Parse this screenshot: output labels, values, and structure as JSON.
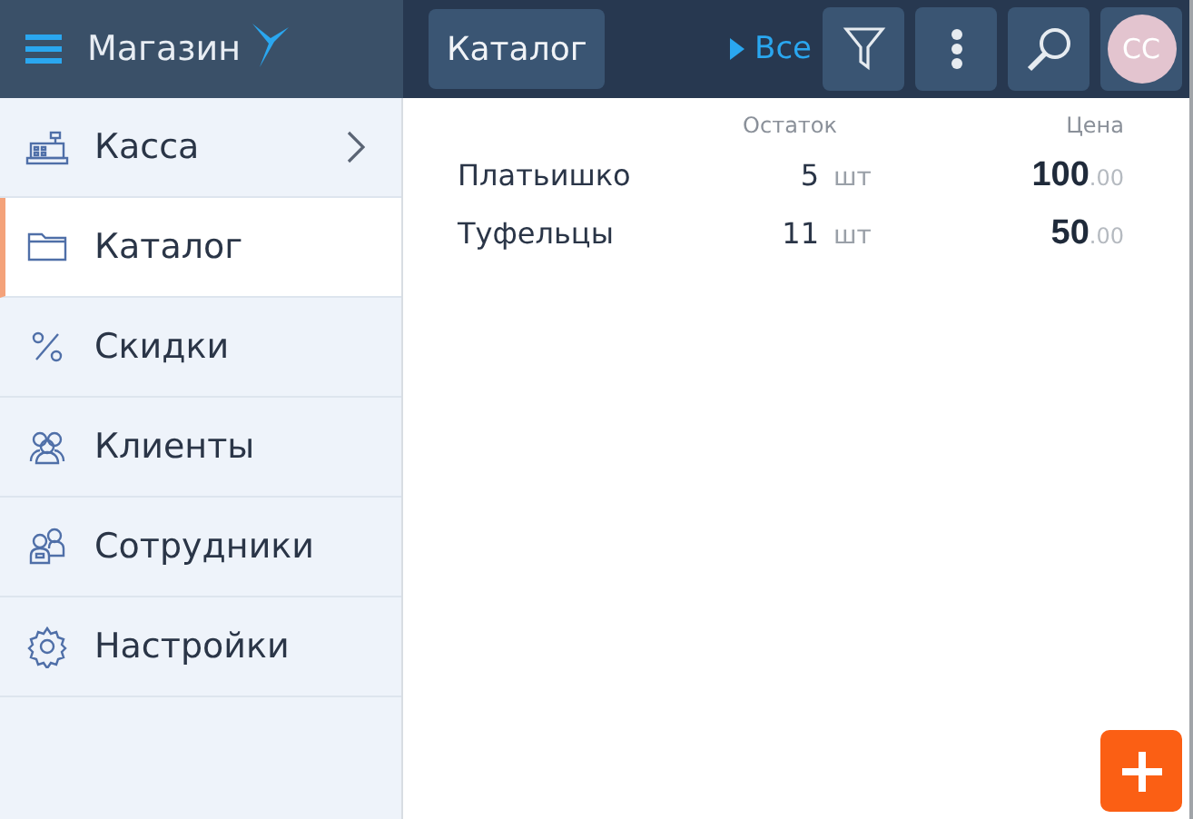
{
  "app": {
    "title": "Магазин"
  },
  "toolbar": {
    "section": "Каталог",
    "filter": "Все",
    "avatar": "СС"
  },
  "sidebar": {
    "items": [
      {
        "label": "Касса",
        "selected": false,
        "kind": "submenu"
      },
      {
        "label": "Каталог",
        "selected": true,
        "kind": "link"
      },
      {
        "label": "Скидки",
        "selected": false,
        "kind": "link"
      },
      {
        "label": "Клиенты",
        "selected": false,
        "kind": "link"
      },
      {
        "label": "Сотрудники",
        "selected": false,
        "kind": "link"
      },
      {
        "label": "Настройки",
        "selected": false,
        "kind": "link"
      }
    ]
  },
  "table": {
    "columns": [
      "Остаток",
      "Цена"
    ],
    "rows": [
      {
        "name": "Платьишко",
        "qty": "5",
        "unit": "шт",
        "price": "100",
        "cents": ".00"
      },
      {
        "name": "Туфельцы",
        "qty": "11",
        "unit": "шт",
        "price": "50",
        "cents": ".00"
      }
    ]
  }
}
